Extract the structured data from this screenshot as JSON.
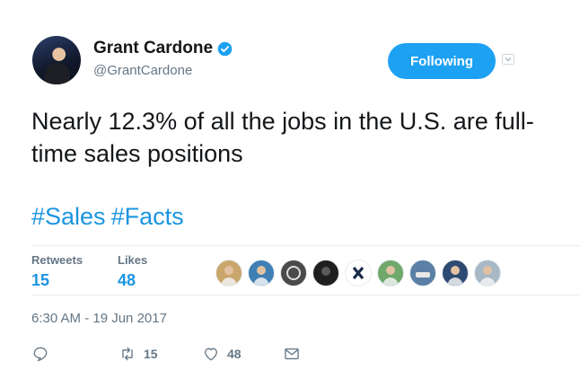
{
  "tweet": {
    "author": {
      "name": "Grant Cardone",
      "handle": "@GrantCardone",
      "verified_icon": "verified-badge-icon"
    },
    "follow_button": {
      "label": "Following"
    },
    "text": "Nearly 12.3% of all the jobs in the U.S. are full-time sales positions",
    "hashtags": [
      "#Sales",
      "#Facts"
    ],
    "stats": {
      "retweets_label": "Retweets",
      "retweets_count": "15",
      "likes_label": "Likes",
      "likes_count": "48"
    },
    "liker_avatars": [
      {
        "icon": "person-avatar",
        "bg": "#c9a66b"
      },
      {
        "icon": "person-avatar",
        "bg": "#3f7fb5"
      },
      {
        "icon": "spiral-logo-avatar",
        "bg": "#4a4a4a"
      },
      {
        "icon": "dark-avatar",
        "bg": "#1f1f1f"
      },
      {
        "icon": "x-logo-avatar",
        "bg": "#ffffff"
      },
      {
        "icon": "person-avatar",
        "bg": "#6fa86a"
      },
      {
        "icon": "car-avatar",
        "bg": "#5b7fa6"
      },
      {
        "icon": "person-avatar",
        "bg": "#2d4a72"
      },
      {
        "icon": "person-avatar",
        "bg": "#a7b8c7"
      }
    ],
    "timestamp": "6:30 AM - 19 Jun 2017",
    "actions": {
      "reply_icon": "reply-icon",
      "retweet_icon": "retweet-icon",
      "retweet_count": "15",
      "like_icon": "heart-icon",
      "like_count": "48",
      "message_icon": "envelope-icon"
    }
  },
  "colors": {
    "accent": "#1da1f2",
    "link": "#1b95e0",
    "text": "#14171a",
    "secondary": "#657786",
    "divider": "#e6ecf0"
  }
}
